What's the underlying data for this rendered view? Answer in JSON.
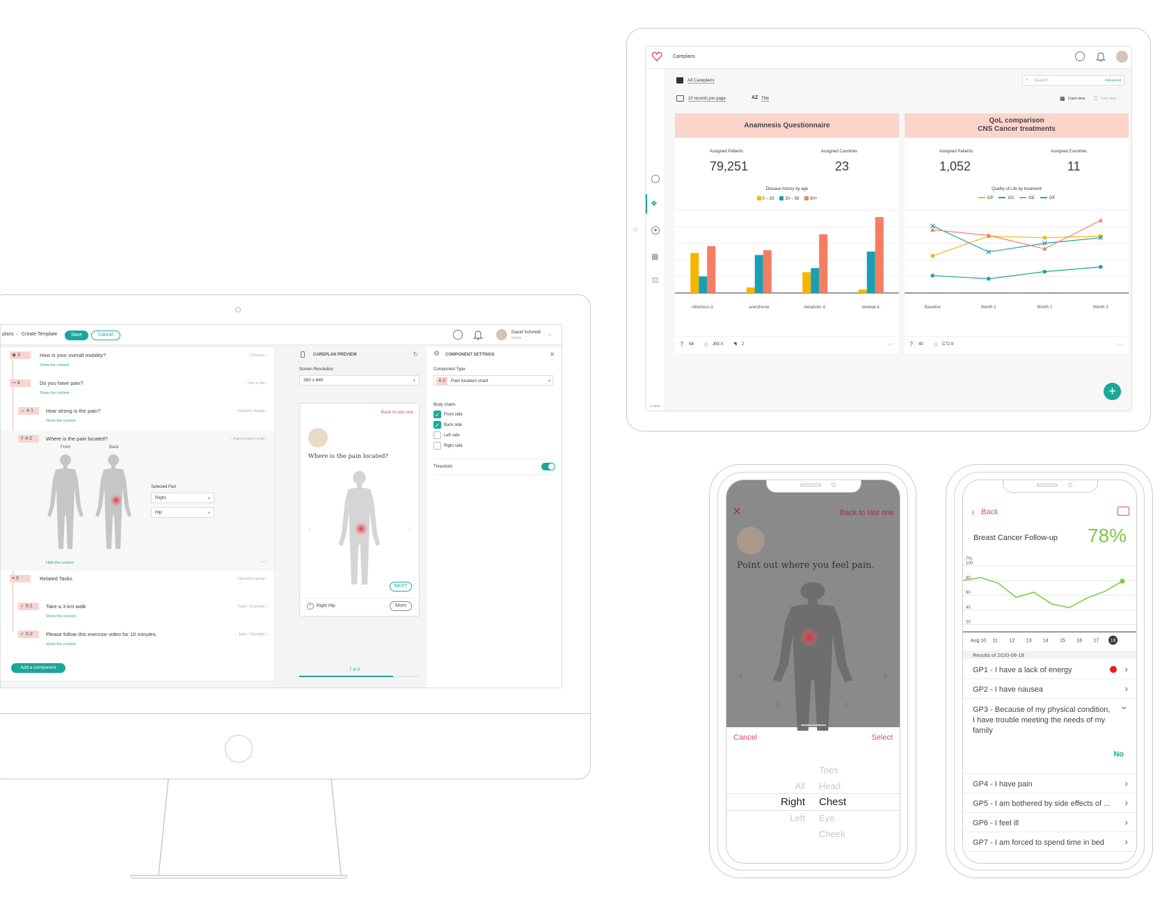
{
  "desktop": {
    "breadcrumb_prev": "plans",
    "breadcrumb_sep": "›",
    "breadcrumb_current": "Create Template",
    "save_label": "Save",
    "cancel_label": "Cancel",
    "user_name": "David Schmidt",
    "user_role": "Doctor",
    "questions": [
      {
        "num": "3",
        "text": "How is your overall mobility?",
        "type": "‹ Choices ›",
        "show": "Show the content"
      },
      {
        "num": "4",
        "text": "Do you have pain?",
        "type": "‹ Yes or No ›",
        "show": "Show the content"
      },
      {
        "num": "4-1",
        "text": "How strong is the pain?",
        "type": "‹ Numeric Range ›",
        "show": "Show the content"
      },
      {
        "num": "4-2",
        "text": "Where is the pain located?",
        "type": "‹ Pain location chart ›"
      },
      {
        "num": "5",
        "text": "Related Tasks",
        "type": "‹ Question group ›"
      },
      {
        "num": "5-1",
        "text": "Take a 3 km walk",
        "type": "‹ Task / Checklist ›",
        "show": "Show the content"
      },
      {
        "num": "5-2",
        "text": "Please follow this exercise video for 10 minutes.",
        "type": "‹ Task / Checklist ›",
        "show": "Show the content"
      }
    ],
    "front_label": "Front",
    "back_label": "Back",
    "selected_part_label": "Selected Part",
    "selected_side": "Right",
    "selected_part": "Hip",
    "hide_content": "Hide the content",
    "add_component": "Add a component",
    "preview": {
      "title": "CAREPLAN PREVIEW",
      "resolution_label": "Screen Resolution",
      "resolution": "360 x 640",
      "back_link": "Back to last one",
      "question": "Where is the pain located?",
      "next": "NEXT",
      "selected": "Right Hip",
      "more": "More",
      "progress": "7 of 9",
      "progress_value": 0.78
    },
    "settings": {
      "title": "COMPONENT SETTINGS",
      "type_label": "Component Type",
      "type_num": "4-2",
      "type_value": "Pain location chart",
      "body_charts_label": "Body charts",
      "options": [
        {
          "label": "Front side",
          "checked": true
        },
        {
          "label": "Back side",
          "checked": true
        },
        {
          "label": "Left side",
          "checked": false
        },
        {
          "label": "Right side",
          "checked": false
        }
      ],
      "threshold_label": "Threshold",
      "threshold_on": true
    }
  },
  "tablet": {
    "header_title": "Careplans",
    "all_careplans": "All Careplans",
    "search_placeholder": "Search",
    "advanced": "Advanced",
    "records": "10 records per page",
    "sort": "Title",
    "card_view": "Card view",
    "list_view": "List view",
    "footer": "© 2019",
    "fab": "+",
    "cards": [
      {
        "title": "Anamnesis Questionnaire",
        "stat1_label": "Assigned Patients",
        "stat1": "79,251",
        "stat2_label": "Assigned Countries",
        "stat2": "23",
        "chart_title": "Disease history by age",
        "foot": [
          "58",
          "J09.X",
          "2"
        ]
      },
      {
        "title_line1": "QoL comparison",
        "title_line2": "CNS Cancer treatments",
        "stat1_label": "Assigned Patients",
        "stat1": "1,052",
        "stat2_label": "Assigned Countries",
        "stat2": "11",
        "chart_title": "Quality of Life by treatment",
        "foot": [
          "40",
          "C72.9"
        ]
      }
    ]
  },
  "phone1": {
    "back_link": "Back to last one",
    "question": "Point out where you feel pain.",
    "cancel": "Cancel",
    "select": "Select",
    "left_col": [
      "",
      "All",
      "Right",
      "Left",
      ""
    ],
    "right_col": [
      "Toes",
      "Head",
      "Chest",
      "Eye",
      "Cheek"
    ],
    "side_r": "R",
    "side_l": "L"
  },
  "phone2": {
    "back": "Back",
    "title": "Breast Cancer Follow-up",
    "percent": "78%",
    "axis_unit": "(%)",
    "results_label": "Results of 2020-08-18",
    "items": [
      {
        "text": "GP1 - I have a lack of energy",
        "alert": true
      },
      {
        "text": "GP2 - I have nausea"
      },
      {
        "text": "GP3 - Because of my physical condition, I have trouble meeting the needs of my family",
        "answer": "No",
        "expanded": true
      },
      {
        "text": "GP4 - I have pain"
      },
      {
        "text": "GP5 - I am bothered by side effects of ..."
      },
      {
        "text": "GP6 - I feel ill"
      },
      {
        "text": "GP7 - I am forced to spend time in bed"
      }
    ]
  },
  "chart_data": [
    {
      "type": "bar",
      "title": "Disease history by age",
      "categories": [
        "infectious d.",
        "anesthesia",
        "metabolic d.",
        "skeletal d."
      ],
      "series": [
        {
          "name": "0 – 29",
          "color": "#f7b500",
          "values": [
            58,
            8,
            30,
            5
          ]
        },
        {
          "name": "30 – 59",
          "color": "#1a9fb0",
          "values": [
            24,
            55,
            36,
            60
          ]
        },
        {
          "name": "60+",
          "color": "#f57d62",
          "values": [
            68,
            62,
            85,
            110
          ]
        }
      ],
      "ylim": [
        0,
        120
      ]
    },
    {
      "type": "line",
      "title": "Quality of Life by treatment",
      "categories": [
        "Baseline",
        "Month 1",
        "Month 2",
        "Month 3"
      ],
      "series": [
        {
          "name": "GP",
          "color": "#f7b500",
          "values": [
            47,
            72,
            70,
            72
          ]
        },
        {
          "name": "GS",
          "color": "#1a9fb0",
          "values": [
            85,
            52,
            63,
            70
          ]
        },
        {
          "name": "GE",
          "color": "#f57d62",
          "values": [
            80,
            73,
            56,
            92
          ]
        },
        {
          "name": "GF",
          "color": "#1aa79a",
          "values": [
            22,
            18,
            27,
            33
          ]
        }
      ],
      "ylim": [
        0,
        105
      ]
    },
    {
      "type": "line",
      "title": "Breast Cancer Follow-up",
      "categories": [
        "Aug 10",
        "11",
        "12",
        "13",
        "14",
        "15",
        "16",
        "17",
        "18"
      ],
      "series": [
        {
          "name": "",
          "color": "#7ac943",
          "values": [
            80,
            84,
            76,
            57,
            64,
            48,
            43,
            56,
            65,
            79
          ]
        }
      ],
      "yticks": [
        100,
        80,
        60,
        40,
        20
      ],
      "ylim": [
        10,
        100
      ]
    }
  ]
}
